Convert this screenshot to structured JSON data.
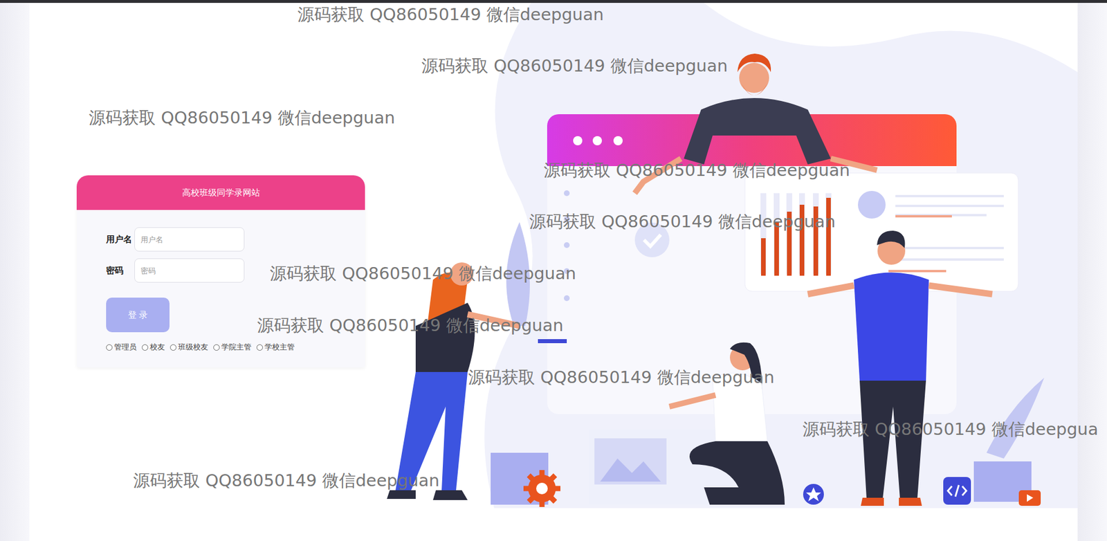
{
  "login": {
    "title": "高校班级同学录网站",
    "username_label": "用户名",
    "username_placeholder": "用户名",
    "password_label": "密码",
    "password_placeholder": "密码",
    "button": "登 录",
    "roles": [
      {
        "label": "管理员",
        "selected": false
      },
      {
        "label": "校友",
        "selected": false
      },
      {
        "label": "班级校友",
        "selected": false
      },
      {
        "label": "学院主管",
        "selected": false
      },
      {
        "label": "学校主管",
        "selected": false
      }
    ]
  },
  "watermarks": [
    "源码获取 QQ86050149 微信deepguan",
    "源码获取 QQ86050149 微信deepguan",
    "源码获取 QQ86050149 微信deepguan",
    "源码获取 QQ86050149 微信deepguan",
    "源码获取 QQ86050149 微信deepguan",
    "源码获取 QQ86050149 微信deepguan",
    "源码获取 QQ86050149 微信deepguan",
    "源码获取 QQ86050149 微信deepguan",
    "源码获取 QQ86050149 微信deepgua",
    "源码获取 QQ86050149 微信deepguan"
  ]
}
